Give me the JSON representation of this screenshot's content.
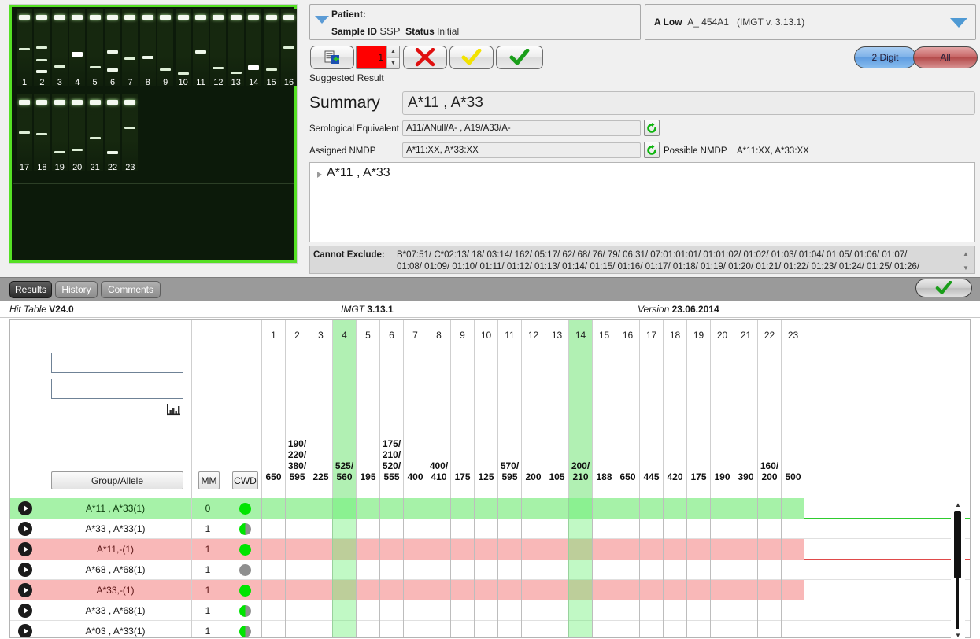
{
  "patient": {
    "header_label": "Patient:",
    "sample_id_label": "Sample ID",
    "sample_id_value": "SSP",
    "status_label": "Status",
    "status_value": "Initial"
  },
  "locus": {
    "resolution": "A Low",
    "kit": "A_ 454A1",
    "imgt": "(IMGT v. 3.13.1)"
  },
  "toolbar": {
    "import_icon": "import-worksheet-icon",
    "spinner_value": "1",
    "reject_icon": "red-x-icon",
    "accept_yellow_icon": "yellow-check-icon",
    "accept_green_icon": "green-check-icon",
    "suggested_result_label": "Suggested Result",
    "two_digit_label": "2 Digit",
    "all_label": "All"
  },
  "summary": {
    "label": "Summary",
    "value": "A*11 , A*33",
    "serological_label": "Serological Equivalent",
    "serological_value": "A11/ANull/A- , A19/A33/A-",
    "assigned_nmdp_label": "Assigned NMDP",
    "assigned_nmdp_value": "A*11:XX, A*33:XX",
    "possible_nmdp_label": "Possible NMDP",
    "possible_nmdp_value": "A*11:XX, A*33:XX",
    "refresh_icon": "refresh-icon"
  },
  "result_tree": {
    "expander_icon": "triangle-right-icon",
    "text": "A*11 , A*33"
  },
  "cannot_exclude": {
    "label": "Cannot Exclude:",
    "line1": "B*07:51/ C*02:13/ 18/ 03:14/ 162/ 05:17/ 62/ 68/ 76/ 79/ 06:31/ 07:01:01:01/ 01:01:02/ 01:02/ 01:03/ 01:04/ 01:05/ 01:06/ 01:07/",
    "line2": "01:08/ 01:09/ 01:10/ 01:11/ 01:12/ 01:13/ 01:14/ 01:15/ 01:16/ 01:17/ 01:18/ 01:19/ 01:20/ 01:21/ 01:22/ 01:23/ 01:24/ 01:25/ 01:26/",
    "scroll_up_icon": "scroll-up-icon",
    "scroll_down_icon": "scroll-down-icon"
  },
  "tabs": {
    "results": "Results",
    "history": "History",
    "comments": "Comments",
    "accept_icon": "green-check-icon"
  },
  "hit_info": {
    "hit_table_label": "Hit Table",
    "hit_table_value": "V24.0",
    "imgt_label": "IMGT",
    "imgt_value": "3.13.1",
    "version_label": "Version",
    "version_value": "23.06.2014"
  },
  "table_controls": {
    "filter1_value": "",
    "filter2_value": "",
    "chart_icon": "bar-chart-icon",
    "group_allele_label": "Group/Allele",
    "mm_label": "MM",
    "cwd_label": "CWD"
  },
  "gel": {
    "lane_labels_row1": [
      "1",
      "2",
      "3",
      "4",
      "5",
      "6",
      "7",
      "8",
      "9",
      "10",
      "11",
      "12",
      "13",
      "14",
      "15",
      "16"
    ],
    "lane_labels_row2": [
      "17",
      "18",
      "19",
      "20",
      "21",
      "22",
      "23"
    ]
  },
  "chart_data": {
    "type": "table",
    "title": "SSP Hit Table — A Low (A_ 454A1)",
    "columns": [
      "1",
      "2",
      "3",
      "4",
      "5",
      "6",
      "7",
      "8",
      "9",
      "10",
      "11",
      "12",
      "13",
      "14",
      "15",
      "16",
      "17",
      "18",
      "19",
      "20",
      "21",
      "22",
      "23"
    ],
    "fragment_sizes": [
      "650",
      "190/\n220/\n380/\n595",
      "225",
      "525/\n560",
      "195",
      "175/\n210/\n520/\n555",
      "400",
      "400/\n410",
      "175",
      "125",
      "570/\n595",
      "200",
      "105",
      "200/\n210",
      "188",
      "650",
      "445",
      "420",
      "175",
      "190",
      "390",
      "160/\n200",
      "500"
    ],
    "highlighted_columns": [
      "4",
      "14"
    ],
    "row_headers": [
      "Group/Allele",
      "MM",
      "CWD"
    ],
    "rows": [
      {
        "allele": "A*11 , A*33(1)",
        "mm": "0",
        "cwd": "green",
        "state": "selected"
      },
      {
        "allele": "A*33 , A*33(1)",
        "mm": "1",
        "cwd": "half",
        "state": "normal"
      },
      {
        "allele": "A*11,-(1)",
        "mm": "1",
        "cwd": "green",
        "state": "rejected"
      },
      {
        "allele": "A*68 , A*68(1)",
        "mm": "1",
        "cwd": "gray",
        "state": "normal"
      },
      {
        "allele": "A*33,-(1)",
        "mm": "1",
        "cwd": "green",
        "state": "rejected"
      },
      {
        "allele": "A*33 , A*68(1)",
        "mm": "1",
        "cwd": "half",
        "state": "normal"
      },
      {
        "allele": "A*03 , A*33(1)",
        "mm": "1",
        "cwd": "half",
        "state": "normal"
      }
    ]
  },
  "scrollbar": {
    "up_icon": "scroll-up-icon",
    "down_icon": "scroll-down-icon"
  }
}
